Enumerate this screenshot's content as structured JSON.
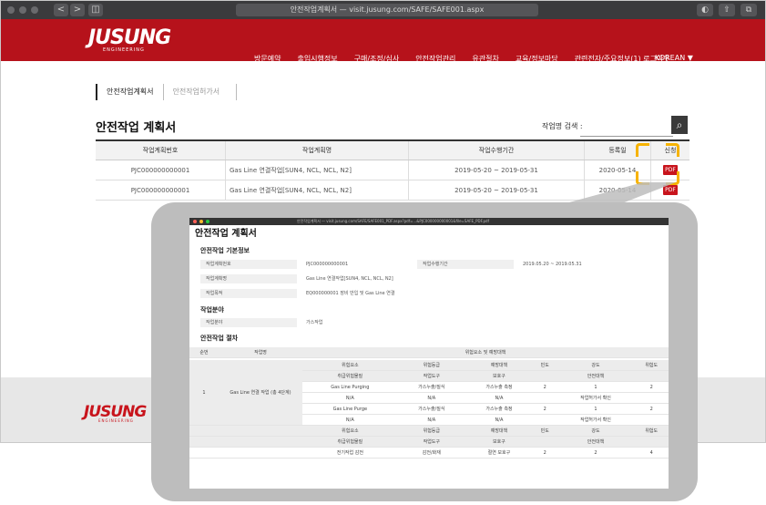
{
  "browser": {
    "url": "안전작업계획서 — visit.jusung.com/SAFE/SAFE001.aspx",
    "nav_back": "<",
    "nav_forward": ">",
    "sidebar_btn": "◫",
    "controls": [
      "◐",
      "⇧",
      "⧉"
    ]
  },
  "site": {
    "logo": "JUSUNG",
    "logo_sub": "ENGINEERING",
    "nav": [
      "방문예약",
      "출입시행정보",
      "구매/조정/심사",
      "안전작업관리",
      "유관절차",
      "교육/정보마당",
      "관련전자/주요정보(1) 로그아웃"
    ],
    "lang": "KOREAN ▼"
  },
  "tabs": [
    "안전작업계획서",
    "안전작업허가서"
  ],
  "page": {
    "title": "안전작업 계획서",
    "search_label": "작업명 검색 :",
    "search_placeholder": "",
    "search_icon": "⌕"
  },
  "table": {
    "headers": [
      "작업계획번호",
      "작업계획명",
      "작업수행기간",
      "등록일",
      "신청"
    ],
    "rows": [
      {
        "no": "PJC000000000001",
        "name": "Gas Line 연결작업[SUN4, NCL, NCL, N2]",
        "period": "2019-05-20 ~ 2019-05-31",
        "date": "2020-05-14",
        "btn": "PDF"
      },
      {
        "no": "PJC000000000001",
        "name": "Gas Line 연결작업[SUN4, NCL, NCL, N2]",
        "period": "2019-05-20 ~ 2019-05-31",
        "date": "2020-05-14",
        "btn": "PDF"
      }
    ]
  },
  "footer": {
    "logo": "JUSUNG",
    "logo_sub": "ENGINEERING"
  },
  "zoom": {
    "url": "안전작업계획서 — visit.jusung.com/SAFE/SAFE001_PDF.aspx?pdf=...&PJC000000000001&file=SAFE_PDF.pdf",
    "title": "안전작업 계획서",
    "sec1": "안전작업 기본정보",
    "rows1": [
      {
        "k": "작업계획번호",
        "v": "PJC000000000001"
      },
      {
        "k": "작업계획명",
        "v": "Gas Line 연결작업[SUN4, NCL, NCL, N2]"
      },
      {
        "k": "작업목적",
        "v": "EQ000000001 장비 반입 및 Gas Line 연결"
      }
    ],
    "period_label": "작업수행기간",
    "period_value": "2019.05.20 ~ 2019.05.31",
    "sec2": "작업분야",
    "row2": {
      "k": "작업분야",
      "v": "가스작업"
    },
    "sec3": "안전작업 절차",
    "sub_headers": [
      "순번",
      "작업명",
      "위험요소 및 예방대책"
    ],
    "sub_row_step": "1",
    "sub_row_name": "Gas Line 연결 작업 (총 4단계)",
    "cells": [
      [
        "위험요소",
        "위험등급",
        "예방대책",
        "빈도",
        "강도",
        "위험도"
      ],
      [
        "취급위험물질",
        "작업도구",
        "보호구",
        "",
        "안전대책",
        ""
      ],
      [
        "Gas Line Purging",
        "가스누출/질식",
        "가스누출 측정",
        "2",
        "1",
        "2"
      ],
      [
        "N/A",
        "N/A",
        "N/A",
        "",
        "작업허가서 확인",
        ""
      ],
      [
        "Gas Line Purge",
        "가스누출/질식",
        "가스누출 측정",
        "2",
        "1",
        "2"
      ],
      [
        "N/A",
        "N/A",
        "N/A",
        "",
        "작업허가서 확인",
        ""
      ],
      [
        "위험요소",
        "위험등급",
        "예방대책",
        "빈도",
        "강도",
        "위험도"
      ],
      [
        "취급위험물질",
        "작업도구",
        "보호구",
        "",
        "안전대책",
        ""
      ],
      [
        "전기작업 감전",
        "감전/화재",
        "절연 보호구",
        "2",
        "2",
        "4"
      ]
    ]
  }
}
